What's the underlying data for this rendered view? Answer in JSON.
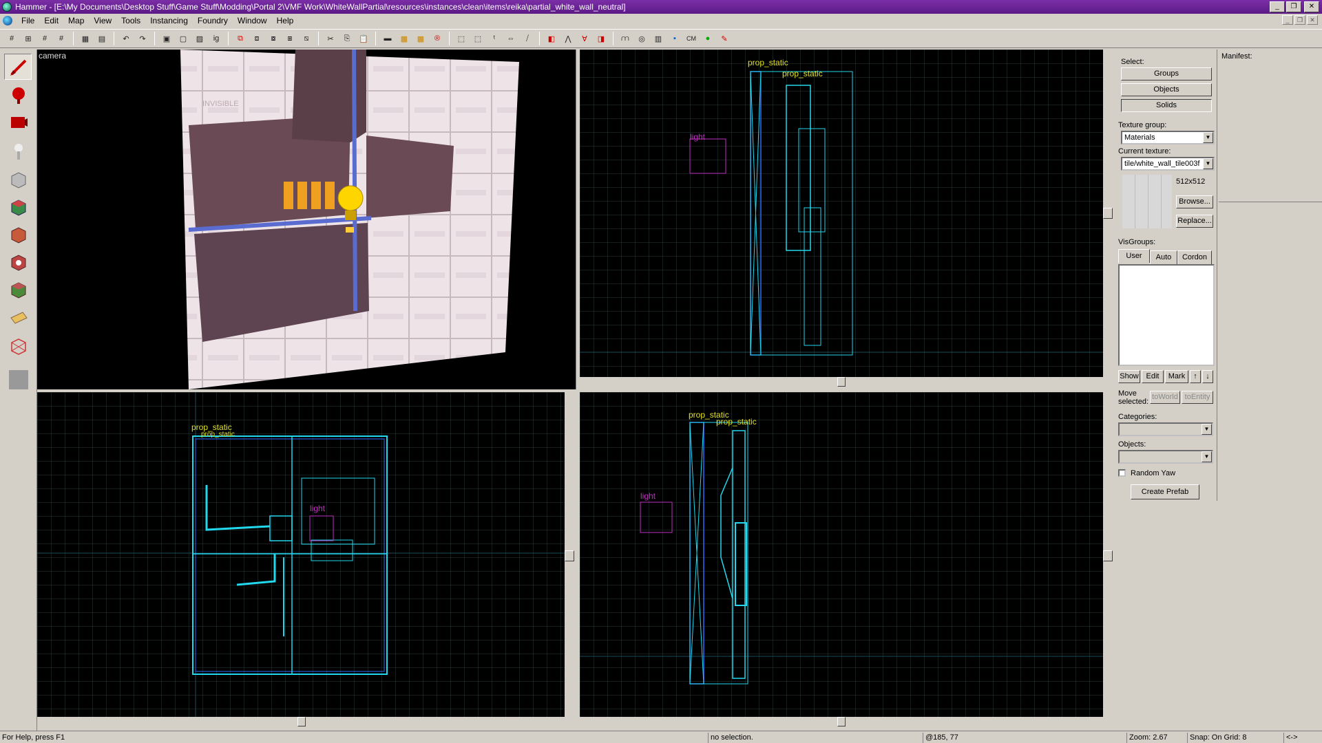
{
  "window": {
    "title": "Hammer - [E:\\My Documents\\Desktop Stuff\\Game Stuff\\Modding\\Portal 2\\VMF Work\\WhiteWallPartial\\resources\\instances\\clean\\items\\reika\\partial_white_wall_neutral]",
    "minimize": "0",
    "restore": "1",
    "close": "r"
  },
  "menu": {
    "items": [
      {
        "label": "File"
      },
      {
        "label": "Edit"
      },
      {
        "label": "Map"
      },
      {
        "label": "View"
      },
      {
        "label": "Tools"
      },
      {
        "label": "Instancing"
      },
      {
        "label": "Foundry"
      },
      {
        "label": "Window"
      },
      {
        "label": "Help"
      }
    ]
  },
  "toolbar": {
    "cm_label": "CM"
  },
  "viewports": {
    "camera": {
      "label": "camera",
      "texture_text": "INVISIBLE"
    },
    "top_right": {
      "prop1": "prop_static",
      "prop2": "prop_static",
      "light": "light"
    },
    "bottom_left": {
      "prop1": "prop_static",
      "prop2": "prop_static",
      "light": "light"
    },
    "bottom_right": {
      "prop1": "prop_static",
      "prop2": "prop_static",
      "light": "light"
    }
  },
  "panel": {
    "select_label": "Select:",
    "groups": "Groups",
    "objects": "Objects",
    "solids": "Solids",
    "texture_group_label": "Texture group:",
    "texture_group_value": "Materials",
    "current_texture_label": "Current texture:",
    "current_texture_value": "tile/white_wall_tile003f",
    "texture_size": "512x512",
    "browse": "Browse...",
    "replace": "Replace...",
    "visgroups_label": "VisGroups:",
    "tab_user": "User",
    "tab_auto": "Auto",
    "tab_cordon": "Cordon",
    "show": "Show",
    "edit": "Edit",
    "mark": "Mark",
    "up": "↑",
    "down": "↓",
    "move_selected": "Move selected:",
    "to_world": "toWorld",
    "to_entity": "toEntity",
    "categories_label": "Categories:",
    "objects_label": "Objects:",
    "random_yaw": "Random Yaw",
    "create_prefab": "Create Prefab"
  },
  "manifest": {
    "label": "Manifest:"
  },
  "status": {
    "help": "For Help, press F1",
    "selection": "no selection.",
    "coords": "@185, 77",
    "zoom": "Zoom: 2.67",
    "snap": "Snap: On Grid: 8",
    "arrows": "<->"
  },
  "colors": {
    "title_bar": "#6a2496",
    "wire_cyan": "#22d8ee",
    "wire_blue": "#2a6cff",
    "entity_magenta": "#c030c0",
    "label_yellow": "#e0e020",
    "grid": "#2a3a3a"
  }
}
